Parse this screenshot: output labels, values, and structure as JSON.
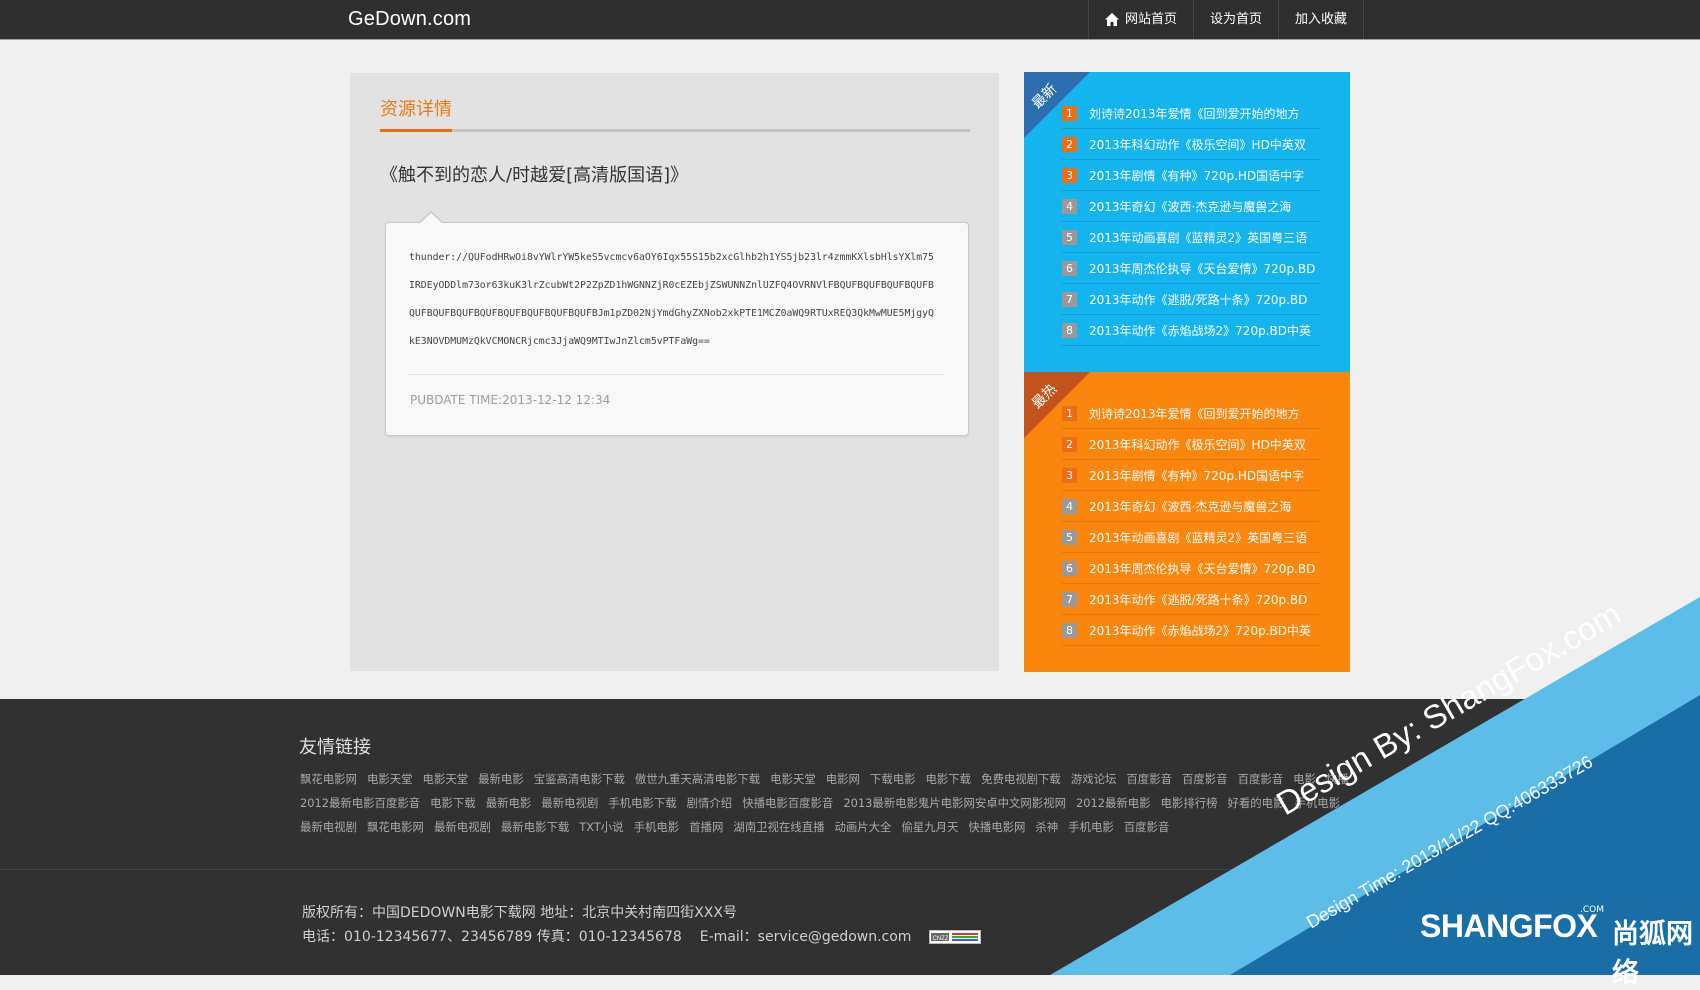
{
  "site": {
    "logo": "GeDown.com"
  },
  "nav": {
    "home_label": "网站首页",
    "set_home_label": "设为首页",
    "favorite_label": "加入收藏"
  },
  "detail": {
    "section_title": "资源详情",
    "resource_name": "《触不到的恋人/时越爱[高清版国语]》",
    "link_lines": [
      "thunder://QUFodHRwOi8vYWlrYW5keS5vcmcv6aOY6Iqx55S15b2xcGlhb2h1YS5jb23lr4zmmKXlsbHlsYXlm75",
      "IRDEyODDlm73or63kuK3lrZcubWt2P2ZpZD1hWGNNZjR0cEZEbjZSWUNNZnlUZFQ4OVRNVlFBQUFBQUFBQUFBQUFB",
      "QUFBQUFBQUFBQUFBQUFBQUFBQUFBQUFBJm1pZD02NjYmdGhyZXNob2xkPTE1MCZ0aWQ9RTUxREQ3QkMwMUE5MjgyQ",
      "kE3NOVDMUMzQkVCMONCRjcmc3JjaWQ9MTIwJnZlcm5vPTFaWg=="
    ],
    "pubdate": "PUBDATE TIME:2013-12-12 12:34"
  },
  "newest": {
    "label": "最新",
    "items": [
      {
        "rank": "1",
        "title": "刘诗诗2013年爱情《回到爱开始的地方"
      },
      {
        "rank": "2",
        "title": "2013年科幻动作《极乐空间》HD中英双"
      },
      {
        "rank": "3",
        "title": "2013年剧情《有种》720p.HD国语中字"
      },
      {
        "rank": "4",
        "title": "2013年奇幻《波西·杰克逊与魔兽之海"
      },
      {
        "rank": "5",
        "title": "2013年动画喜剧《蓝精灵2》英国粤三语"
      },
      {
        "rank": "6",
        "title": "2013年周杰伦执导《天台爱情》720p.BD"
      },
      {
        "rank": "7",
        "title": "2013年动作《逃脱/死路十条》720p.BD"
      },
      {
        "rank": "8",
        "title": "2013年动作《赤焰战场2》720p.BD中英"
      }
    ]
  },
  "hottest": {
    "label": "最热",
    "items": [
      {
        "rank": "1",
        "title": "刘诗诗2013年爱情《回到爱开始的地方"
      },
      {
        "rank": "2",
        "title": "2013年科幻动作《极乐空间》HD中英双"
      },
      {
        "rank": "3",
        "title": "2013年剧情《有种》720p.HD国语中字"
      },
      {
        "rank": "4",
        "title": "2013年奇幻《波西·杰克逊与魔兽之海"
      },
      {
        "rank": "5",
        "title": "2013年动画喜剧《蓝精灵2》英国粤三语"
      },
      {
        "rank": "6",
        "title": "2013年周杰伦执导《天台爱情》720p.BD"
      },
      {
        "rank": "7",
        "title": "2013年动作《逃脱/死路十条》720p.BD"
      },
      {
        "rank": "8",
        "title": "2013年动作《赤焰战场2》720p.BD中英"
      }
    ]
  },
  "footer": {
    "friends_title": "友情链接",
    "friends_links": [
      "飘花电影网",
      "电影天堂",
      "电影天堂",
      "最新电影",
      "宝鉴高清电影下载",
      "傲世九重天高清电影下载",
      "电影天堂",
      "电影网",
      "下载电影",
      "电影下载",
      "免费电视剧下载",
      "游戏论坛",
      "百度影音",
      "百度影音",
      "百度影音",
      "电影",
      "快播",
      "2012最新电影百度影音",
      "电影下载",
      "最新电影",
      "最新电视剧",
      "手机电影下载",
      "剧情介绍",
      "快播电影百度影音",
      "2013最新电影鬼片电影网安卓中文网影视网",
      "2012最新电影",
      "电影排行榜",
      "好看的电影",
      "手机电影",
      "最新电视剧",
      "飘花电影网",
      "最新电视剧",
      "最新电影下载",
      "TXT小说",
      "手机电影",
      "首播网",
      "湖南卫视在线直播",
      "动画片大全",
      "偷星九月天",
      "快播电影网",
      "杀神",
      "手机电影",
      "百度影音"
    ],
    "copyright": "版权所有：中国DEDOWN电影下载网 地址：北京中关村南四街XXX号",
    "contact": "电话：010-12345677、23456789 传真：010-12345678",
    "email": "E-mail：service@gedown.com",
    "badge": "CNZZ"
  },
  "watermark": {
    "design_by": "Design By:    ShangFox.com",
    "design_time": "Design Time: 2013/11/22   QQ:406333726",
    "logo": "SHANGFOX",
    "logo_cn": "尚狐网络",
    "com": ".COM"
  },
  "colors": {
    "topbar": "#2f2f2f",
    "accent_orange": "#ec7a12",
    "newest_bg": "#14b4ef",
    "hottest_bg": "#fa860d",
    "footer_bg": "#313131",
    "watermark_blue_light": "#5bbde8",
    "watermark_blue_dark": "#1a6ea8"
  }
}
